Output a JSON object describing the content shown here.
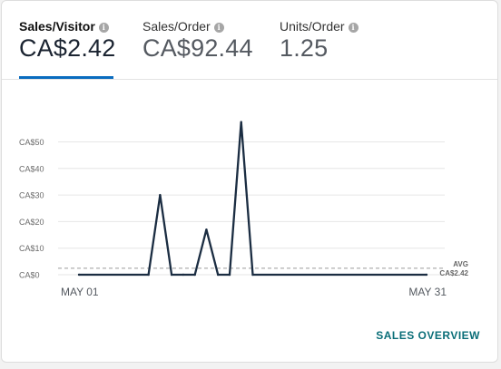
{
  "metrics": [
    {
      "label": "Sales/Visitor",
      "value": "CA$2.42",
      "active": true
    },
    {
      "label": "Sales/Order",
      "value": "CA$92.44",
      "active": false
    },
    {
      "label": "Units/Order",
      "value": "1.25",
      "active": false
    }
  ],
  "info_icon_glyph": "i",
  "footer": {
    "link_label": "SALES OVERVIEW"
  },
  "colors": {
    "accent": "#0a6cbf",
    "line": "#1b2d42",
    "link": "#0a6e78"
  },
  "chart_data": {
    "type": "line",
    "series": [
      {
        "points": [
          [
            "MAY 01",
            0
          ],
          [
            "MAY 07",
            0
          ],
          [
            "MAY 08",
            30
          ],
          [
            "MAY 09",
            0
          ],
          [
            "MAY 10",
            0
          ],
          [
            "MAY 11",
            0
          ],
          [
            "MAY 12",
            17
          ],
          [
            "MAY 13",
            0
          ],
          [
            "MAY 14",
            0
          ],
          [
            "MAY 15",
            57.5
          ],
          [
            "MAY 16",
            0
          ],
          [
            "MAY 31",
            0
          ]
        ]
      }
    ],
    "x_tick_labels": [
      "MAY 01",
      "MAY 31"
    ],
    "y_ticks": [
      "CA$0",
      "CA$10",
      "CA$20",
      "CA$30",
      "CA$40",
      "CA$50"
    ],
    "y_tick_values": [
      0,
      10,
      20,
      30,
      40,
      50
    ],
    "ylim": [
      0,
      60
    ],
    "grid": true,
    "average": {
      "label": "AVG",
      "value": 2.42,
      "value_label": "CA$2.42"
    }
  }
}
